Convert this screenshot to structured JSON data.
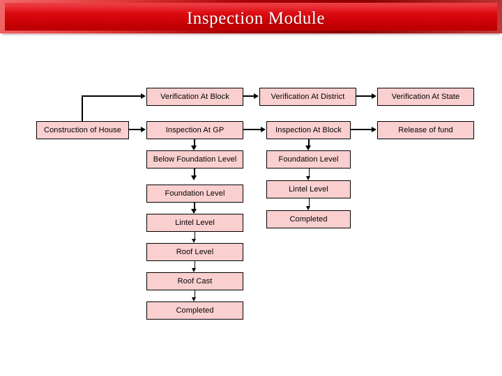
{
  "header": {
    "title": "Inspection Module",
    "banner_color_top": "#e8141c",
    "banner_color_bottom": "#bb0002",
    "title_color": "#ffffff"
  },
  "theme": {
    "node_fill": "#facfcf",
    "node_border": "#000000",
    "canvas_background": "#ffffff",
    "connector_color": "#000000"
  },
  "chart_data": {
    "type": "diagram",
    "title": "Inspection Module",
    "diagram_kind": "flowchart",
    "columns": [
      {
        "name": "start",
        "nodes": [
          "Construction of House"
        ]
      },
      {
        "name": "gp-chain",
        "nodes": [
          "Verification At Block",
          "Inspection At GP",
          "Below Foundation Level",
          "Foundation Level",
          "Lintel Level",
          "Roof Level",
          "Roof Cast",
          "Completed"
        ]
      },
      {
        "name": "block-chain",
        "nodes": [
          "Verification At District",
          "Inspection At Block",
          "Foundation Level",
          "Lintel Level",
          "Completed"
        ]
      },
      {
        "name": "state-chain",
        "nodes": [
          "Verification At State",
          "Release of fund"
        ]
      }
    ],
    "edges": [
      {
        "from": "Construction of House",
        "to": "Verification At Block",
        "style": "elbow-up-right"
      },
      {
        "from": "Construction of House",
        "to": "Inspection At GP",
        "style": "right"
      },
      {
        "from": "Verification At Block",
        "to": "Verification At District",
        "style": "right"
      },
      {
        "from": "Verification At District",
        "to": "Verification At State",
        "style": "right"
      },
      {
        "from": "Inspection At GP",
        "to": "Inspection At Block",
        "style": "right"
      },
      {
        "from": "Inspection At Block",
        "to": "Release of fund",
        "style": "right"
      },
      {
        "from": "Inspection At GP",
        "to": "Below Foundation Level",
        "style": "down"
      },
      {
        "from": "Below Foundation Level",
        "to": "Foundation Level",
        "style": "down"
      },
      {
        "from": "Foundation Level",
        "to": "Lintel Level",
        "style": "down"
      },
      {
        "from": "Lintel Level",
        "to": "Roof Level",
        "style": "down"
      },
      {
        "from": "Roof Level",
        "to": "Roof Cast",
        "style": "down"
      },
      {
        "from": "Roof Cast",
        "to": "Completed",
        "style": "down"
      },
      {
        "from": "Inspection At Block",
        "to": "Foundation Level (block)",
        "style": "down"
      },
      {
        "from": "Foundation Level (block)",
        "to": "Lintel Level (block)",
        "style": "down"
      },
      {
        "from": "Lintel Level (block)",
        "to": "Completed (block)",
        "style": "down"
      }
    ]
  },
  "nodes": {
    "construction_of_house": "Construction of House",
    "verification_at_block": "Verification At Block",
    "verification_at_district": "Verification At District",
    "verification_at_state": "Verification At State",
    "inspection_at_gp": "Inspection At GP",
    "inspection_at_block": "Inspection At Block",
    "release_of_fund": "Release of fund",
    "gp_below_foundation_level": "Below Foundation Level",
    "gp_foundation_level": "Foundation Level",
    "gp_lintel_level": "Lintel Level",
    "gp_roof_level": "Roof Level",
    "gp_roof_cast": "Roof Cast",
    "gp_completed": "Completed",
    "block_foundation_level": "Foundation Level",
    "block_lintel_level": "Lintel Level",
    "block_completed": "Completed"
  }
}
